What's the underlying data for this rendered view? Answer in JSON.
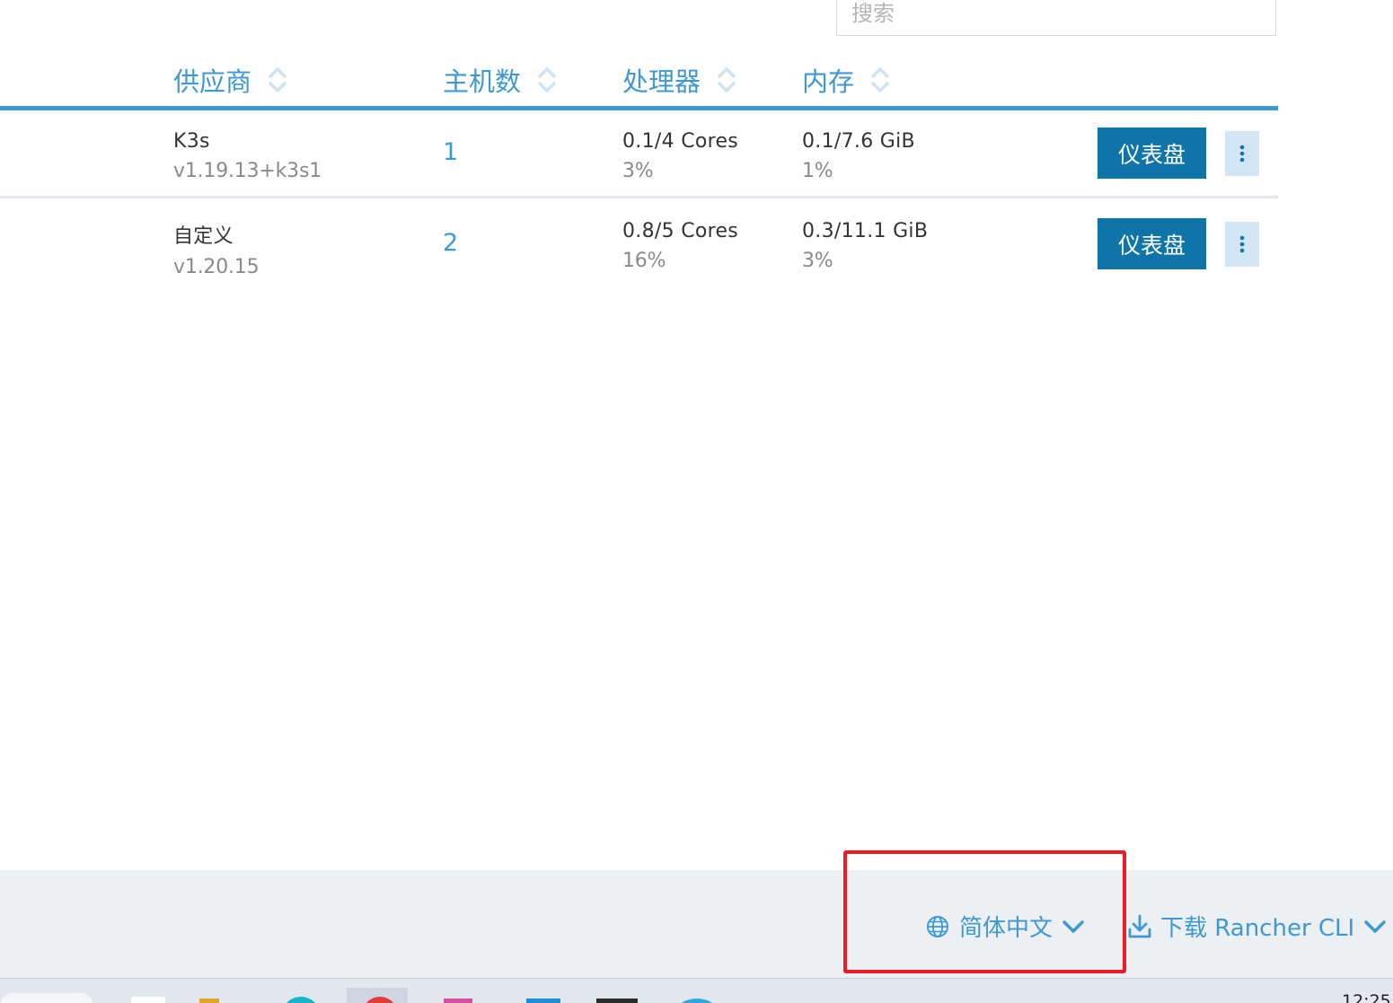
{
  "search": {
    "placeholder": "搜索"
  },
  "table": {
    "columns": [
      {
        "label": "供应商"
      },
      {
        "label": "主机数"
      },
      {
        "label": "处理器"
      },
      {
        "label": "内存"
      }
    ],
    "rows": [
      {
        "provider": "K3s",
        "version": "v1.19.13+k3s1",
        "hosts": "1",
        "cpu": "0.1/4 Cores",
        "cpu_pct": "3%",
        "memory": "0.1/7.6 GiB",
        "memory_pct": "1%",
        "action_label": "仪表盘"
      },
      {
        "provider": "自定义",
        "version": "v1.20.15",
        "hosts": "2",
        "cpu": "0.8/5 Cores",
        "cpu_pct": "16%",
        "memory": "0.3/11.1 GiB",
        "memory_pct": "3%",
        "action_label": "仪表盘"
      }
    ]
  },
  "footer": {
    "language_label": "简体中文",
    "download_label": "下载 Rancher CLI"
  },
  "taskbar": {
    "time": "12:25"
  },
  "icons": {
    "sort": "sort-icon",
    "kebab": "kebab-menu-icon",
    "globe": "globe-icon",
    "chevron": "chevron-down-icon",
    "download": "download-icon"
  },
  "colors": {
    "accent": "#3d98d3",
    "button": "#0f75a9",
    "kebab_bg": "#d2e6f5",
    "footer_bg": "#edf0f2",
    "highlight": "#ec1c24"
  }
}
